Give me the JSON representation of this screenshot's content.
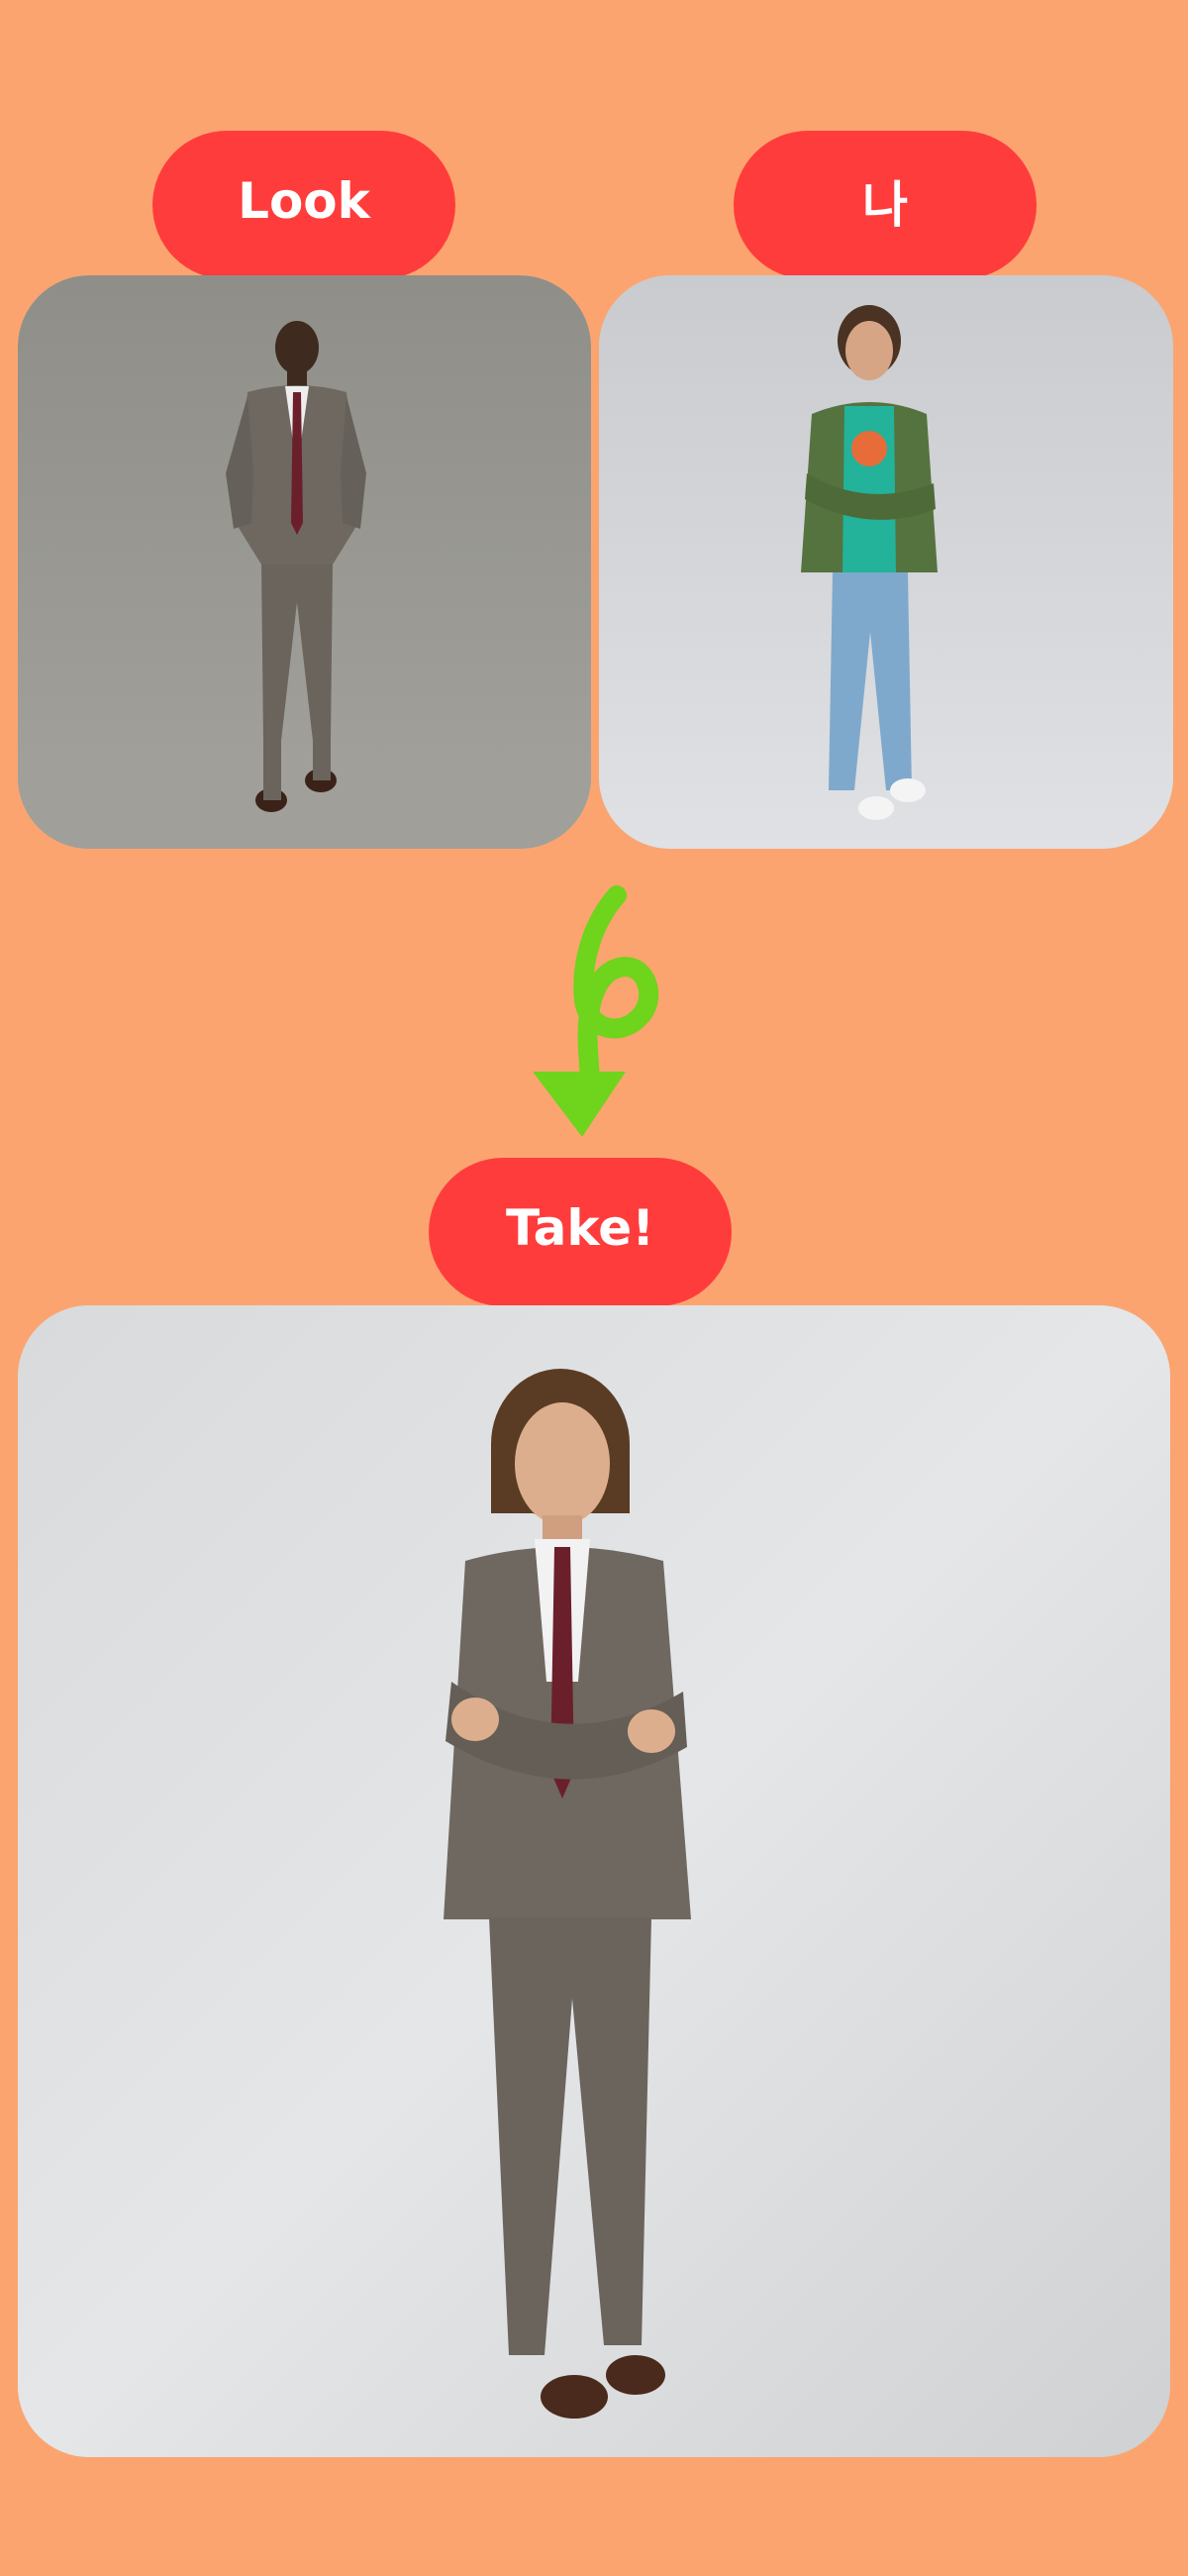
{
  "labels": {
    "look": "Look",
    "me": "나",
    "take": "Take!"
  },
  "images": {
    "look": "suit-model-photo",
    "me": "casual-model-photo",
    "result": "result-photo"
  },
  "icons": {
    "arrow": "curly-down-arrow-icon"
  },
  "colors": {
    "background": "#FCA46F",
    "pill": "#FF3C3C",
    "arrow": "#6ED41C",
    "suit": "#6E6860",
    "tie": "#6B1F2A",
    "hoodie": "#55733F",
    "tshirt": "#22B39A",
    "jeans": "#7FA9CC"
  }
}
